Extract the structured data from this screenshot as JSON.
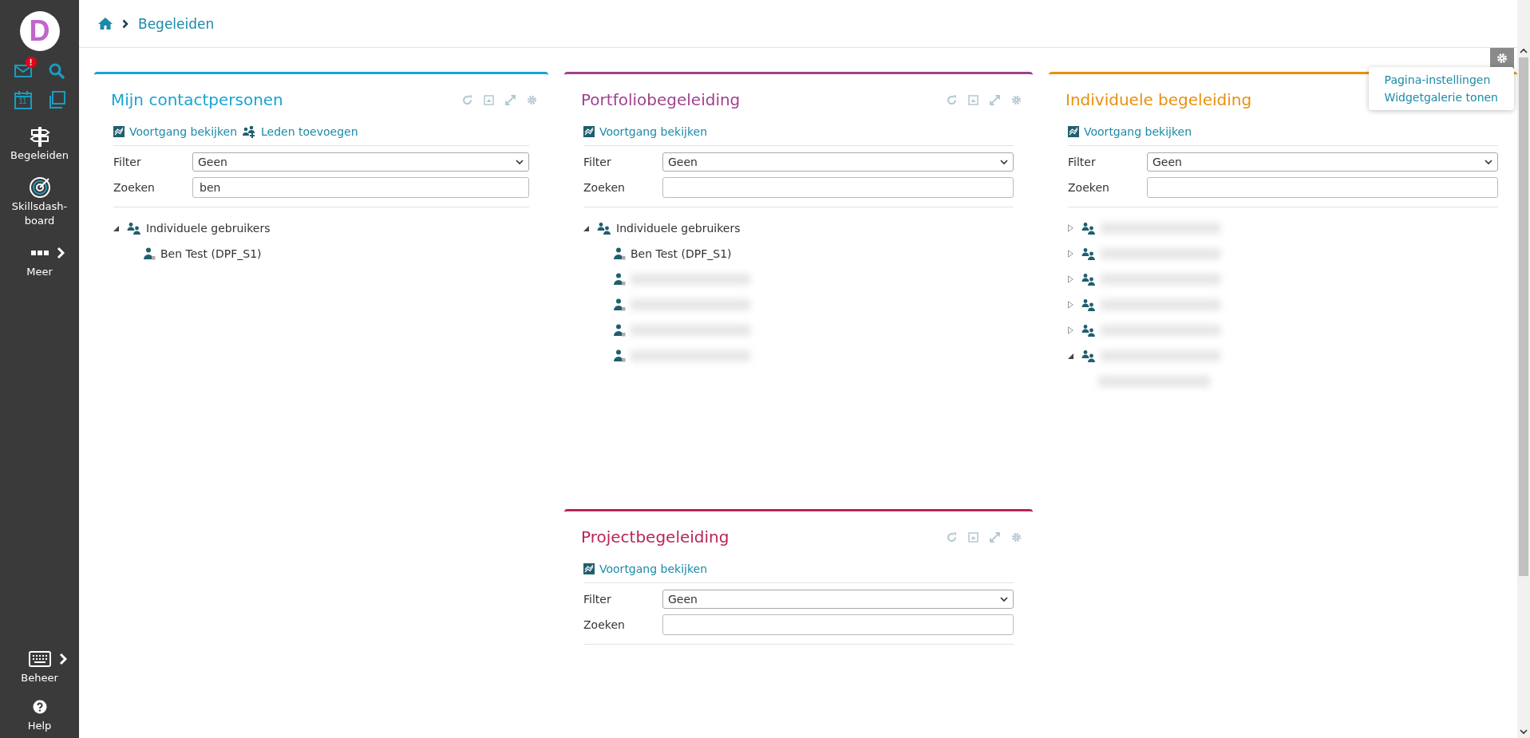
{
  "sidebar": {
    "logo": "D",
    "mail_badge": "!",
    "calendar_day": "11",
    "items": [
      {
        "label": "Begeleiden",
        "kind": "signpost",
        "chevron": false
      },
      {
        "label": "Skillsdash-board",
        "kind": "target",
        "chevron": false
      },
      {
        "label": "Meer",
        "kind": "more",
        "chevron": true
      }
    ],
    "bottom_items": [
      {
        "label": "Beheer",
        "kind": "keyboard",
        "chevron": true
      },
      {
        "label": "Help",
        "kind": "help",
        "chevron": false
      }
    ]
  },
  "breadcrumb": {
    "items": [
      "Begeleiden"
    ]
  },
  "page_menu": {
    "items": [
      "Pagina-instellingen",
      "Widgetgalerie tonen"
    ]
  },
  "widgets": [
    {
      "title": "Mijn contactpersonen",
      "color": "#1aa3d4",
      "tools": true,
      "actions": [
        {
          "label": "Voortgang bekijken",
          "kind": "progress"
        },
        {
          "label": "Leden toevoegen",
          "kind": "add-members"
        }
      ],
      "filter": {
        "label": "Filter",
        "value": "Geen"
      },
      "search": {
        "label": "Zoeken",
        "value": "ben"
      },
      "tree": [
        {
          "label": "Individuele gebruikers",
          "kind": "group",
          "expanded": true,
          "children": [
            {
              "label": "Ben Test (DPF_S1)",
              "kind": "user"
            }
          ]
        }
      ]
    },
    {
      "title": "Portfoliobegeleiding",
      "color": "#a0428f",
      "tools": true,
      "actions": [
        {
          "label": "Voortgang bekijken",
          "kind": "progress"
        }
      ],
      "filter": {
        "label": "Filter",
        "value": "Geen"
      },
      "search": {
        "label": "Zoeken"
      },
      "tree": [
        {
          "label": "Individuele gebruikers",
          "kind": "group",
          "expanded": true,
          "children": [
            {
              "label": "Ben Test (DPF_S1)",
              "kind": "user"
            },
            {
              "kind": "user"
            },
            {
              "kind": "user"
            },
            {
              "kind": "user"
            },
            {
              "kind": "user"
            }
          ]
        }
      ]
    },
    {
      "title": "Individuele begeleiding",
      "color": "#e8900f",
      "tools": false,
      "actions": [
        {
          "label": "Voortgang bekijken",
          "kind": "progress"
        }
      ],
      "filter": {
        "label": "Filter",
        "value": "Geen"
      },
      "search": {
        "label": "Zoeken"
      },
      "tree": [
        {
          "kind": "group",
          "expanded": false
        },
        {
          "kind": "group",
          "expanded": false
        },
        {
          "kind": "group",
          "expanded": false
        },
        {
          "kind": "group",
          "expanded": false
        },
        {
          "kind": "group",
          "expanded": false
        },
        {
          "kind": "group",
          "expanded": true,
          "children": [
            {
              "kind": "hidden"
            }
          ]
        }
      ]
    },
    {
      "title": "Projectbegeleiding",
      "color": "#b8245a",
      "actions": [
        {
          "label": "Voortgang bekijken",
          "kind": "progress"
        }
      ],
      "filter": {
        "label": "Filter",
        "value": "Geen"
      },
      "search": {
        "label": "Zoeken"
      },
      "tools": true
    }
  ]
}
